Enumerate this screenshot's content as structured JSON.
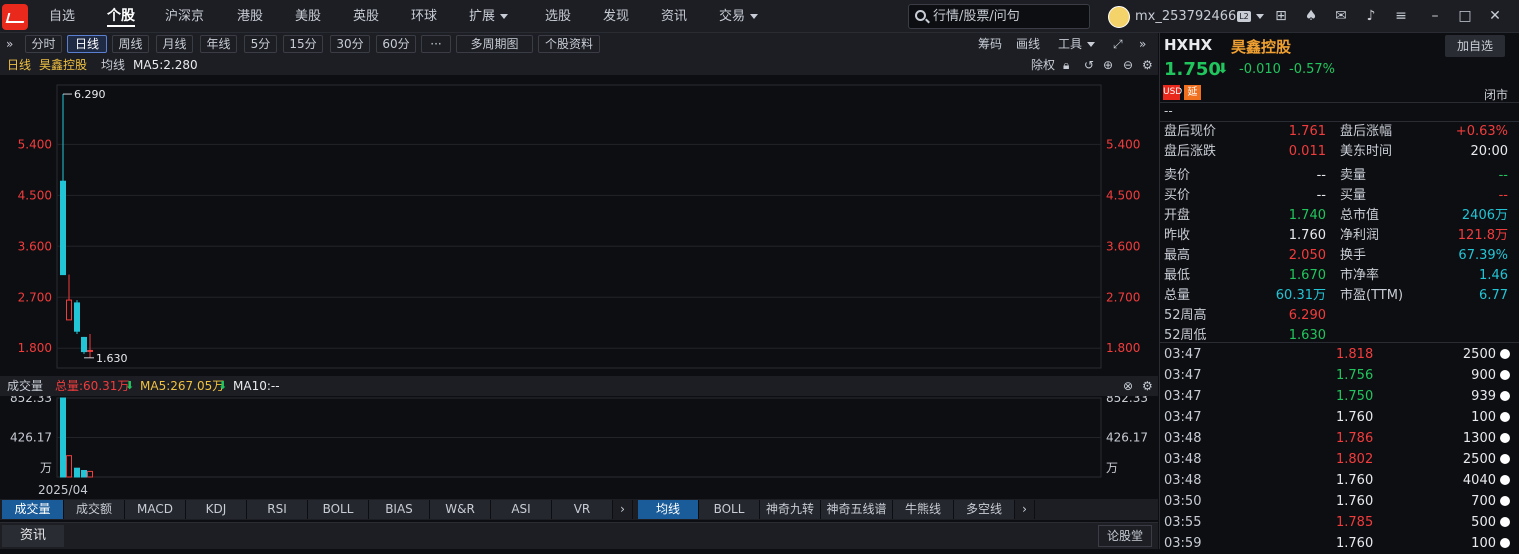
{
  "topnav": {
    "items": [
      "自选",
      "个股",
      "沪深京",
      "港股",
      "美股",
      "英股",
      "环球",
      "扩展",
      "选股",
      "发现",
      "资讯",
      "交易"
    ],
    "active": "个股",
    "search_placeholder": "行情/股票/问句",
    "username": "mx_253792466",
    "level_badge": "L2"
  },
  "toolbar": {
    "periods": [
      "分时",
      "日线",
      "周线",
      "月线",
      "年线",
      "5分",
      "15分",
      "30分",
      "60分",
      "···",
      "多周期图",
      "个股资料"
    ],
    "active": "日线",
    "right": [
      "筹码",
      "画线",
      "工具"
    ]
  },
  "info": {
    "period_label": "日线",
    "stock_name": "昊鑫控股",
    "ma_label": "均线",
    "ma5": "MA5:2.280",
    "right_label": "除权"
  },
  "chart_data": {
    "type": "candlestick",
    "y_ticks": [
      "5.400",
      "4.500",
      "3.600",
      "2.700",
      "1.800"
    ],
    "ylim": [
      1.45,
      6.45
    ],
    "high_label": "6.290",
    "low_label": "1.630",
    "candles": [
      {
        "open": 3.1,
        "close": 4.75,
        "high": 6.29,
        "low": 3.1,
        "dir": "up"
      },
      {
        "open": 2.65,
        "close": 2.3,
        "high": 3.1,
        "low": 2.3,
        "dir": "down"
      },
      {
        "open": 2.1,
        "close": 2.6,
        "high": 2.65,
        "low": 2.05,
        "dir": "up"
      },
      {
        "open": 1.74,
        "close": 1.99,
        "high": 2.0,
        "low": 1.7,
        "dir": "up"
      },
      {
        "open": 1.76,
        "close": 1.75,
        "high": 2.05,
        "low": 1.63,
        "dir": "down"
      }
    ],
    "volume": {
      "y_ticks": [
        "852.33",
        "426.17",
        "万"
      ],
      "max": 852.33,
      "values": [
        852.33,
        230,
        95,
        70,
        60.31
      ],
      "dirs": [
        "up",
        "down",
        "up",
        "up",
        "down"
      ],
      "x_label": "2025/04"
    }
  },
  "volume_header": {
    "title": "成交量",
    "total": "总量:60.31万",
    "ma5": "MA5:267.05万",
    "ma10": "MA10:--"
  },
  "indicators_left": [
    "成交量",
    "成交额",
    "MACD",
    "KDJ",
    "RSI",
    "BOLL",
    "BIAS",
    "W&R",
    "ASI",
    "VR"
  ],
  "indicators_right": [
    "均线",
    "BOLL",
    "神奇九转",
    "神奇五线谱",
    "牛熊线",
    "多空线"
  ],
  "bottom": {
    "news_tab": "资讯",
    "forum_button": "论股堂"
  },
  "side": {
    "code": "HXHX",
    "name": "昊鑫控股",
    "add_button": "加自选",
    "price": "1.750",
    "change": "-0.010",
    "change_pct": "-0.57%",
    "badges": [
      "USD",
      "延"
    ],
    "status": "闭市",
    "dash": "--",
    "quotes": [
      {
        "l1": "盘后现价",
        "v1": "1.761",
        "c1": "red",
        "l2": "盘后涨幅",
        "v2": "+0.63%",
        "c2": "red"
      },
      {
        "l1": "盘后涨跌",
        "v1": "0.011",
        "c1": "red",
        "l2": "美东时间",
        "v2": "20:00",
        "c2": "white"
      },
      {
        "l1": "卖价",
        "v1": "--",
        "c1": "white",
        "l2": "卖量",
        "v2": "--",
        "c2": "green"
      },
      {
        "l1": "买价",
        "v1": "--",
        "c1": "white",
        "l2": "买量",
        "v2": "--",
        "c2": "red"
      },
      {
        "l1": "开盘",
        "v1": "1.740",
        "c1": "green",
        "l2": "总市值",
        "v2": "2406万",
        "c2": "cyan"
      },
      {
        "l1": "昨收",
        "v1": "1.760",
        "c1": "white",
        "l2": "净利润",
        "v2": "121.8万",
        "c2": "red"
      },
      {
        "l1": "最高",
        "v1": "2.050",
        "c1": "red",
        "l2": "换手",
        "v2": "67.39%",
        "c2": "cyan"
      },
      {
        "l1": "最低",
        "v1": "1.670",
        "c1": "green",
        "l2": "市净率",
        "v2": "1.46",
        "c2": "cyan"
      },
      {
        "l1": "总量",
        "v1": "60.31万",
        "c1": "cyan",
        "l2": "市盈(TTM)",
        "v2": "6.77",
        "c2": "cyan"
      },
      {
        "l1": "52周高",
        "v1": "6.290",
        "c1": "red",
        "l2": "",
        "v2": "",
        "c2": "white"
      },
      {
        "l1": "52周低",
        "v1": "1.630",
        "c1": "green",
        "l2": "",
        "v2": "",
        "c2": "white"
      }
    ],
    "trades": [
      {
        "time": "03:47",
        "price": "1.818",
        "pc": "red",
        "vol": "2500"
      },
      {
        "time": "03:47",
        "price": "1.756",
        "pc": "green",
        "vol": "900"
      },
      {
        "time": "03:47",
        "price": "1.750",
        "pc": "green",
        "vol": "939"
      },
      {
        "time": "03:47",
        "price": "1.760",
        "pc": "white",
        "vol": "100"
      },
      {
        "time": "03:48",
        "price": "1.786",
        "pc": "red",
        "vol": "1300"
      },
      {
        "time": "03:48",
        "price": "1.802",
        "pc": "red",
        "vol": "2500"
      },
      {
        "time": "03:48",
        "price": "1.760",
        "pc": "white",
        "vol": "4040"
      },
      {
        "time": "03:50",
        "price": "1.760",
        "pc": "white",
        "vol": "700"
      },
      {
        "time": "03:55",
        "price": "1.785",
        "pc": "red",
        "vol": "500"
      },
      {
        "time": "03:59",
        "price": "1.760",
        "pc": "white",
        "vol": "100"
      }
    ]
  }
}
